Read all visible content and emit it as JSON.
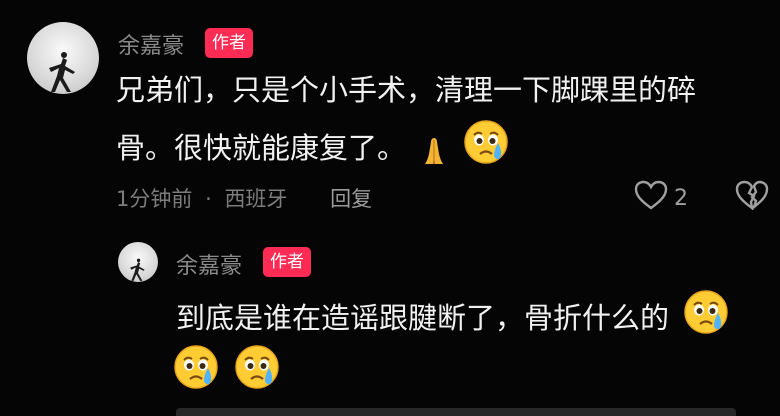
{
  "comment": {
    "username": "余嘉豪",
    "badge": "作者",
    "text_line1": "兄弟们，只是个小手术，清理一下脚踝里的碎",
    "text_line2": "骨。很快就能康复了。",
    "emojis": [
      "folded-hands-icon",
      "crying-face-icon"
    ],
    "time": "1分钟前",
    "separator": "·",
    "location": "西班牙",
    "reply_label": "回复",
    "like_count": "2"
  },
  "reply": {
    "username": "余嘉豪",
    "badge": "作者",
    "text_line1": "到底是谁在造谣跟腱断了，骨折什么的",
    "emojis": [
      "crying-face-icon",
      "crying-face-icon",
      "crying-face-icon"
    ]
  },
  "colors": {
    "background": "#050505",
    "badge": "#fe2c55",
    "username": "#8a8a8a",
    "text": "#f1f1f1",
    "emoji_face": "#ffcc33"
  }
}
